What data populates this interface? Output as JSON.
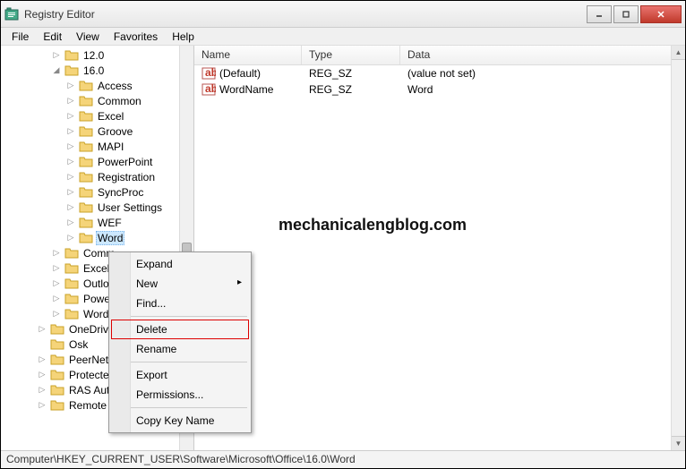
{
  "window": {
    "title": "Registry Editor"
  },
  "menu": {
    "file": "File",
    "edit": "Edit",
    "view": "View",
    "favorites": "Favorites",
    "help": "Help"
  },
  "tree": {
    "items": [
      {
        "indent": 3,
        "twisty": "▷",
        "label": "12.0"
      },
      {
        "indent": 3,
        "twisty": "◢",
        "label": "16.0"
      },
      {
        "indent": 4,
        "twisty": "▷",
        "label": "Access"
      },
      {
        "indent": 4,
        "twisty": "▷",
        "label": "Common"
      },
      {
        "indent": 4,
        "twisty": "▷",
        "label": "Excel"
      },
      {
        "indent": 4,
        "twisty": "▷",
        "label": "Groove"
      },
      {
        "indent": 4,
        "twisty": "▷",
        "label": "MAPI"
      },
      {
        "indent": 4,
        "twisty": "▷",
        "label": "PowerPoint"
      },
      {
        "indent": 4,
        "twisty": "▷",
        "label": "Registration"
      },
      {
        "indent": 4,
        "twisty": "▷",
        "label": "SyncProc"
      },
      {
        "indent": 4,
        "twisty": "▷",
        "label": "User Settings"
      },
      {
        "indent": 4,
        "twisty": "▷",
        "label": "WEF"
      },
      {
        "indent": 4,
        "twisty": "▷",
        "label": "Word",
        "selected": true
      },
      {
        "indent": 3,
        "twisty": "▷",
        "label": "Comm"
      },
      {
        "indent": 3,
        "twisty": "▷",
        "label": "Excel"
      },
      {
        "indent": 3,
        "twisty": "▷",
        "label": "Outlo"
      },
      {
        "indent": 3,
        "twisty": "▷",
        "label": "Power"
      },
      {
        "indent": 3,
        "twisty": "▷",
        "label": "Word"
      },
      {
        "indent": 2,
        "twisty": "▷",
        "label": "OneDrive"
      },
      {
        "indent": 2,
        "twisty": "",
        "label": "Osk"
      },
      {
        "indent": 2,
        "twisty": "▷",
        "label": "PeerNet"
      },
      {
        "indent": 2,
        "twisty": "▷",
        "label": "Protected"
      },
      {
        "indent": 2,
        "twisty": "▷",
        "label": "RAS Auto"
      },
      {
        "indent": 2,
        "twisty": "▷",
        "label": "Remote A"
      }
    ]
  },
  "list": {
    "headers": {
      "name": "Name",
      "type": "Type",
      "data": "Data"
    },
    "rows": [
      {
        "name": "(Default)",
        "type": "REG_SZ",
        "data": "(value not set)"
      },
      {
        "name": "WordName",
        "type": "REG_SZ",
        "data": "Word"
      }
    ]
  },
  "context_menu": {
    "expand": "Expand",
    "new": "New",
    "find": "Find...",
    "delete": "Delete",
    "rename": "Rename",
    "export": "Export",
    "permissions": "Permissions...",
    "copy_key_name": "Copy Key Name"
  },
  "statusbar": {
    "path": "Computer\\HKEY_CURRENT_USER\\Software\\Microsoft\\Office\\16.0\\Word"
  },
  "watermark": "mechanicalengblog.com"
}
